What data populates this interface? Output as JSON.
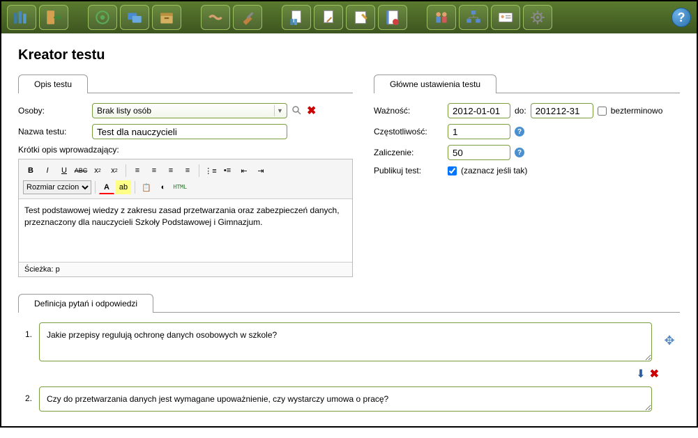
{
  "page_title": "Kreator testu",
  "tabs": {
    "description": "Opis testu",
    "settings": "Główne ustawienia testu",
    "questions": "Definicja pytań i odpowiedzi"
  },
  "form": {
    "people_label": "Osoby:",
    "people_value": "Brak listy osób",
    "name_label": "Nazwa testu:",
    "name_value": "Test dla nauczycieli",
    "intro_label": "Krótki opis wprowadzający:"
  },
  "editor": {
    "font_size_label": "Rozmiar czcion",
    "content": "Test podstawowej wiedzy z zakresu zasad przetwarzania oraz zabezpieczeń danych, przeznaczony dla nauczycieli Szkoły Podstawowej i Gimnazjum.",
    "path": "Ścieżka: p",
    "html_label": "HTML"
  },
  "settings": {
    "validity_label": "Ważność:",
    "date_from": "2012-01-01",
    "date_to_label": "do:",
    "date_to": "201212-31",
    "unlimited_label": "bezterminowo",
    "frequency_label": "Częstotliwość:",
    "frequency_value": "1",
    "pass_label": "Zaliczenie:",
    "pass_value": "50",
    "publish_label": "Publikuj test:",
    "publish_hint": "(zaznacz jeśli tak)"
  },
  "questions": [
    {
      "num": "1.",
      "text": "Jakie przepisy regulują ochronę danych osobowych w szkole?"
    },
    {
      "num": "2.",
      "text": "Czy do przetwarzania danych jest wymagane upoważnienie, czy wystarczy umowa o pracę?"
    }
  ]
}
